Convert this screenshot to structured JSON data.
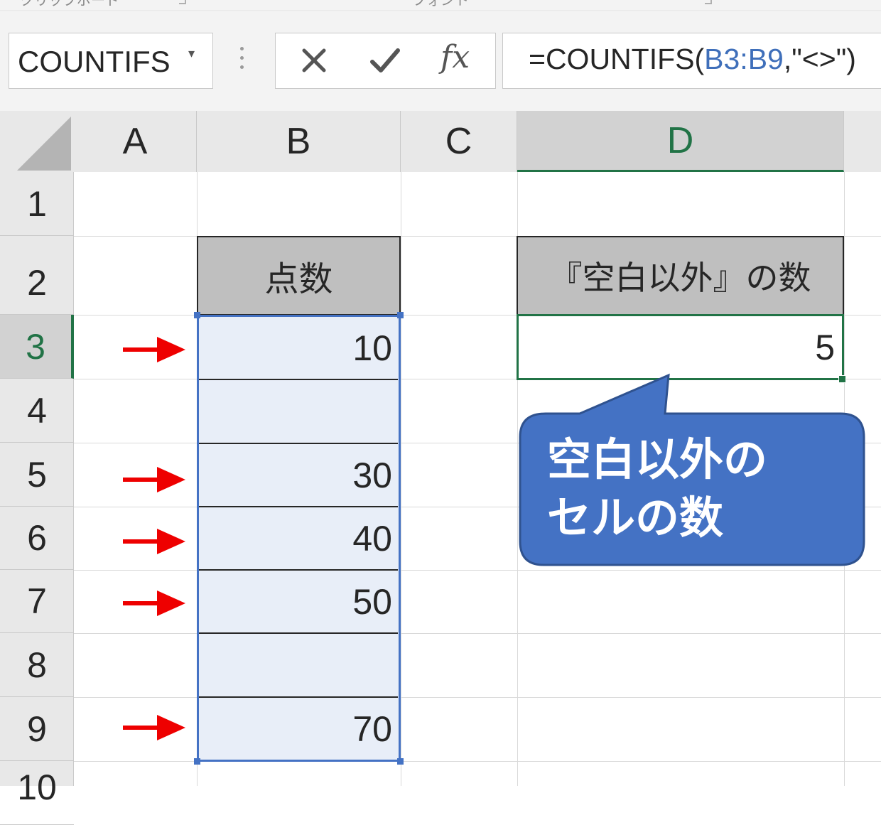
{
  "ribbon": {
    "groups": [
      "クリップボード",
      "フォント"
    ]
  },
  "formula_bar": {
    "name_box": "COUNTIFS",
    "formula_prefix": "=COUNTIFS(",
    "formula_ref": "B3:B9",
    "formula_suffix": ",\"<>\")"
  },
  "columns": [
    "A",
    "B",
    "C",
    "D"
  ],
  "active_column": "D",
  "rows": [
    "1",
    "2",
    "3",
    "4",
    "5",
    "6",
    "7",
    "8",
    "9",
    "10"
  ],
  "active_row": "3",
  "cells": {
    "B2": "点数",
    "D2": "『空白以外』の数",
    "D3": "5",
    "B_values": [
      "10",
      "",
      "30",
      "40",
      "50",
      "",
      "70"
    ]
  },
  "callout": {
    "line1": "空白以外の",
    "line2": "セルの数"
  },
  "colors": {
    "arrow": "#ee0000",
    "selection": "#4472c4",
    "active_cell": "#217346",
    "callout_fill": "#4472c4"
  }
}
